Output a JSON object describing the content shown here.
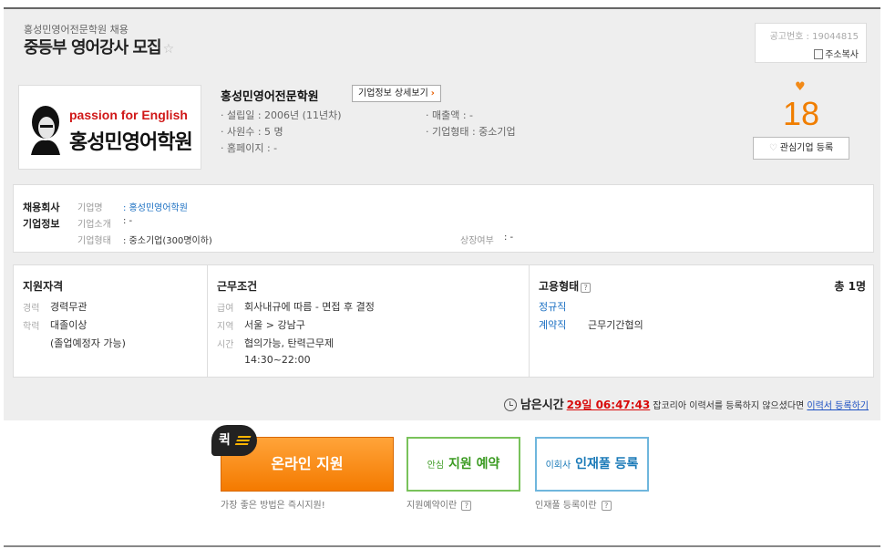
{
  "header": {
    "company_recruit": "홍성민영어전문학원 채용",
    "title": "중등부 영어강사 모집",
    "post_no": "공고번호 : 19044815",
    "copy_address": "주소복사"
  },
  "logo": {
    "en": "passion for English",
    "ko": "홍성민영어학원"
  },
  "company": {
    "name": "홍성민영어전문학원",
    "detail_button": "기업정보 상세보기",
    "founded": "· 설립일   : 2006년 (11년차)",
    "employees": "· 사원수   : 5 명",
    "homepage": "· 홈페이지 : -",
    "revenue": "· 매출액    : -",
    "type": "· 기업형태 : 중소기업"
  },
  "favorite": {
    "count": "18",
    "button": "관심기업 등록"
  },
  "company_info": {
    "heading_1": "채용회사",
    "heading_2": "기업정보",
    "name_label": "기업명",
    "name_value": ": 홍성민영어학원",
    "intro_label": "기업소개",
    "intro_value": ": -",
    "type_label": "기업형태",
    "type_value": ": 중소기업(300명이하)",
    "listed_label": "상장여부",
    "listed_value": ": -"
  },
  "qualification": {
    "title": "지원자격",
    "career_label": "경력",
    "career_value": "경력무관",
    "edu_label": "학력",
    "edu_value": "대졸이상",
    "edu_note": "(졸업예정자 가능)"
  },
  "conditions": {
    "title": "근무조건",
    "pay_label": "급여",
    "pay_value": "회사내규에 따름 - 면접 후 결정",
    "region_label": "지역",
    "region_value": "서울 > 강남구",
    "time_label": "시간",
    "time_value": "협의가능, 탄력근무제",
    "time_hours": "14:30~22:00"
  },
  "employment": {
    "title": "고용형태",
    "total": "총 1명",
    "type_1": "정규직",
    "type_2": "계약직",
    "type_2_note": "근무기간협의"
  },
  "remaining": {
    "label": "남은시간",
    "countdown": "29일 06:47:43",
    "notice": "잡코리아 이력서를 등록하지 않으셨다면",
    "link": "이력서 등록하기"
  },
  "actions": {
    "quick_badge": "퀵",
    "apply": "온라인 지원",
    "apply_hint": "가장 좋은 방법은 즉시지원!",
    "reserve_pre": "안심",
    "reserve": "지원 예약",
    "reserve_hint": "지원예약이란",
    "pool_pre": "이회사",
    "pool": "인재풀 등록",
    "pool_hint": "인재풀 등록이란"
  }
}
